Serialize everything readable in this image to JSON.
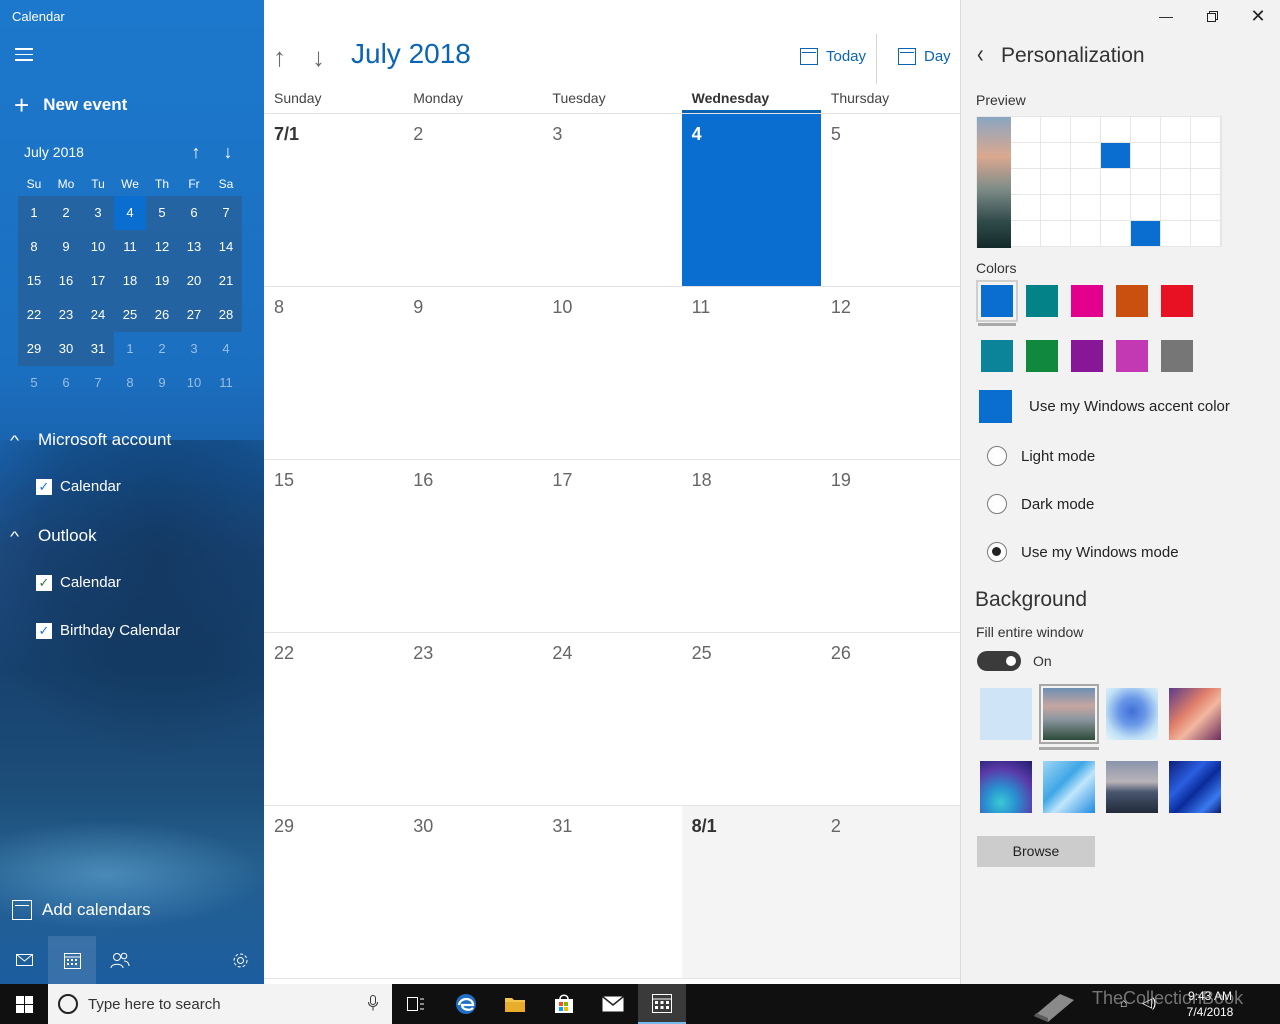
{
  "sidebar": {
    "app_title": "Calendar",
    "new_event_label": "New event",
    "mini_calendar": {
      "title": "July 2018",
      "weekdays": [
        "Su",
        "Mo",
        "Tu",
        "We",
        "Th",
        "Fr",
        "Sa"
      ],
      "days": [
        {
          "label": "1",
          "state": "cur"
        },
        {
          "label": "2",
          "state": "cur"
        },
        {
          "label": "3",
          "state": "cur"
        },
        {
          "label": "4",
          "state": "sel"
        },
        {
          "label": "5",
          "state": "cur"
        },
        {
          "label": "6",
          "state": "cur"
        },
        {
          "label": "7",
          "state": "cur"
        },
        {
          "label": "8",
          "state": "cur"
        },
        {
          "label": "9",
          "state": "cur"
        },
        {
          "label": "10",
          "state": "cur"
        },
        {
          "label": "11",
          "state": "cur"
        },
        {
          "label": "12",
          "state": "cur"
        },
        {
          "label": "13",
          "state": "cur"
        },
        {
          "label": "14",
          "state": "cur"
        },
        {
          "label": "15",
          "state": "cur"
        },
        {
          "label": "16",
          "state": "cur"
        },
        {
          "label": "17",
          "state": "cur"
        },
        {
          "label": "18",
          "state": "cur"
        },
        {
          "label": "19",
          "state": "cur"
        },
        {
          "label": "20",
          "state": "cur"
        },
        {
          "label": "21",
          "state": "cur"
        },
        {
          "label": "22",
          "state": "cur"
        },
        {
          "label": "23",
          "state": "cur"
        },
        {
          "label": "24",
          "state": "cur"
        },
        {
          "label": "25",
          "state": "cur"
        },
        {
          "label": "26",
          "state": "cur"
        },
        {
          "label": "27",
          "state": "cur"
        },
        {
          "label": "28",
          "state": "cur"
        },
        {
          "label": "29",
          "state": "cur"
        },
        {
          "label": "30",
          "state": "cur"
        },
        {
          "label": "31",
          "state": "cur"
        },
        {
          "label": "1",
          "state": "other"
        },
        {
          "label": "2",
          "state": "other"
        },
        {
          "label": "3",
          "state": "other"
        },
        {
          "label": "4",
          "state": "other"
        },
        {
          "label": "5",
          "state": "other"
        },
        {
          "label": "6",
          "state": "other"
        },
        {
          "label": "7",
          "state": "other"
        },
        {
          "label": "8",
          "state": "other"
        },
        {
          "label": "9",
          "state": "other"
        },
        {
          "label": "10",
          "state": "other"
        },
        {
          "label": "11",
          "state": "other"
        }
      ]
    },
    "accounts": [
      {
        "name": "Microsoft account",
        "calendars": [
          {
            "name": "Calendar",
            "checked": true,
            "color": "#1a73e8"
          }
        ]
      },
      {
        "name": "Outlook",
        "calendars": [
          {
            "name": "Calendar",
            "checked": true,
            "color": "#2e7d32"
          },
          {
            "name": "Birthday Calendar",
            "checked": true,
            "color": "#1a73e8"
          }
        ]
      }
    ],
    "add_calendars_label": "Add calendars",
    "bottom_icons": [
      "mail-icon",
      "calendar-icon",
      "people-icon",
      "settings-icon"
    ]
  },
  "main": {
    "month_title": "July 2018",
    "today_label": "Today",
    "day_label": "Day",
    "weekdays": [
      "Sunday",
      "Monday",
      "Tuesday",
      "Wednesday",
      "Thursday"
    ],
    "today_column": 3,
    "weeks": [
      [
        {
          "label": "7/1",
          "style": "bold"
        },
        {
          "label": "2"
        },
        {
          "label": "3"
        },
        {
          "label": "4",
          "style": "today"
        },
        {
          "label": "5"
        }
      ],
      [
        {
          "label": "8"
        },
        {
          "label": "9"
        },
        {
          "label": "10"
        },
        {
          "label": "11"
        },
        {
          "label": "12"
        }
      ],
      [
        {
          "label": "15"
        },
        {
          "label": "16"
        },
        {
          "label": "17"
        },
        {
          "label": "18"
        },
        {
          "label": "19"
        }
      ],
      [
        {
          "label": "22"
        },
        {
          "label": "23"
        },
        {
          "label": "24"
        },
        {
          "label": "25"
        },
        {
          "label": "26"
        }
      ],
      [
        {
          "label": "29"
        },
        {
          "label": "30"
        },
        {
          "label": "31"
        },
        {
          "label": "8/1",
          "style": "bold-grey"
        },
        {
          "label": "2",
          "style": "grey"
        }
      ]
    ]
  },
  "panel": {
    "title": "Personalization",
    "preview_label": "Preview",
    "colors_label": "Colors",
    "colors": [
      "#0a6ed1",
      "#038387",
      "#e3008c",
      "#ca5010",
      "#e81123",
      "#0b849a",
      "#10893e",
      "#881798",
      "#c239b3",
      "#767676"
    ],
    "selected_color": 0,
    "accent_label": "Use my Windows accent color",
    "modes": [
      {
        "label": "Light mode",
        "selected": false
      },
      {
        "label": "Dark mode",
        "selected": false
      },
      {
        "label": "Use my Windows mode",
        "selected": true
      }
    ],
    "background_title": "Background",
    "fill_label": "Fill entire window",
    "toggle_state": "On",
    "backgrounds": [
      {
        "name": "light-blue",
        "fill": "#cfe4f7"
      },
      {
        "name": "mountain",
        "fill": "linear-gradient(180deg,#6d8fb4 0%,#c6a6a0 35%,#8c97a0 60%,#2d4a3a 100%)"
      },
      {
        "name": "tree",
        "fill": "radial-gradient(circle at 50% 45%,#3f6fd8 0%,#6a98e8 35%,#bfe0f5 70%,#e8f5fb 100%)"
      },
      {
        "name": "canyon",
        "fill": "linear-gradient(135deg,#5a3c8a 0%,#e07f6a 40%,#f3b7a0 60%,#6a2c5a 100%)"
      },
      {
        "name": "teal-waves",
        "fill": "radial-gradient(circle at 40% 80%,#39c9d6 0%,#2a8fd0 30%,#5a3aa8 65%,#1e1e6e 100%)"
      },
      {
        "name": "geometric-blue",
        "fill": "linear-gradient(135deg,#9fd6f5 0%,#3fa6e6 40%,#bfe6fb 60%,#1f8ae0 100%)"
      },
      {
        "name": "lake",
        "fill": "linear-gradient(180deg,#8a94ac 0%,#b9b3b8 40%,#48566e 60%,#222a3a 100%)"
      },
      {
        "name": "blue-lines",
        "fill": "linear-gradient(135deg,#0d1e7a 0%,#2a5fe0 35%,#0a2a9a 55%,#3a7af0 80%,#0a1a6a 100%)"
      }
    ],
    "selected_background": 1,
    "browse_label": "Browse"
  },
  "taskbar": {
    "search_placeholder": "Type here to search",
    "time": "9:43 AM",
    "date": "7/4/2018",
    "watermark": "TheCollectionBook"
  }
}
